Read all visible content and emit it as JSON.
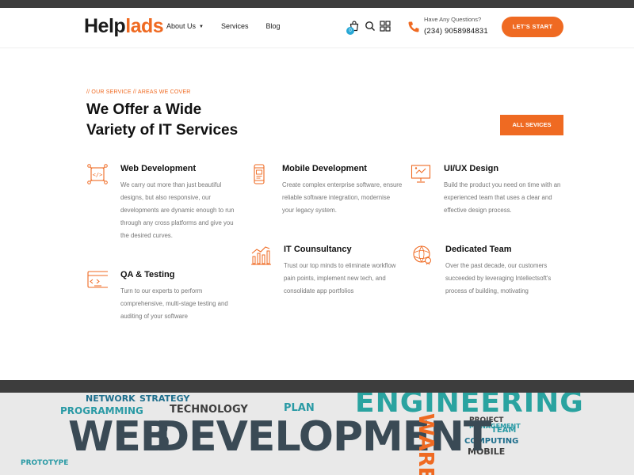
{
  "header": {
    "logo_part1": "Help",
    "logo_part2": "lads",
    "nav": [
      {
        "label": "About Us",
        "has_caret": true
      },
      {
        "label": "Services",
        "has_caret": false
      },
      {
        "label": "Blog",
        "has_caret": false
      }
    ],
    "cart_count": "0",
    "contact_label": "Have Any Questions?",
    "contact_number": "(234) 9058984831",
    "cta_label": "LET'S START"
  },
  "section": {
    "kicker": "// OUR SERVICE // AREAS WE COVER",
    "heading_line1": "We Offer a Wide",
    "heading_line2": "Variety of IT Services",
    "all_button": "ALL SEVICES"
  },
  "services": [
    {
      "title": "Web Development",
      "icon": "web-dev-icon",
      "desc": "We carry out more than just beautiful designs, but also responsive, our developments are dynamic enough to run through any cross platforms and give you the desired curves."
    },
    {
      "title": "Mobile Development",
      "icon": "mobile-icon",
      "desc": "Create complex enterprise software, ensure reliable software integration, modernise your legacy system."
    },
    {
      "title": "UI/UX Design",
      "icon": "monitor-icon",
      "desc": "Build the product you need on time with an experienced team that uses a clear and effective design process."
    },
    {
      "title": "QA & Testing",
      "icon": "qa-icon",
      "desc": "Turn to our experts to perform comprehensive, multi-stage testing and auditing of your software"
    },
    {
      "title": "IT Counsultancy",
      "icon": "chart-icon",
      "desc": "Trust our top minds to eliminate workflow pain points, implement new tech, and consolidate app portfolios"
    },
    {
      "title": "Dedicated Team",
      "icon": "team-icon",
      "desc": "Over the past decade, our customers succeeded by leveraging Intellectsoft's process of building, motivating"
    }
  ],
  "banner_words": {
    "main1": "WEB",
    "main2": "DEVELOPMENT",
    "engineering": "ENGINEERING",
    "ware": "WARE",
    "network": "NETWORK",
    "strategy": "STRATEGY",
    "programming": "PROGRAMMING",
    "technology": "TECHNOLOGY",
    "plan": "PLAN",
    "prototype": "PROTOTYPE",
    "computing": "COMPUTING",
    "mobile": "MOBILE",
    "team": "TEAM",
    "management": "MANAGEMENT",
    "project": "PROJECT"
  },
  "colors": {
    "accent": "#ef6a22",
    "dark_bar": "#3d3d3d",
    "badge": "#29a8d6"
  }
}
